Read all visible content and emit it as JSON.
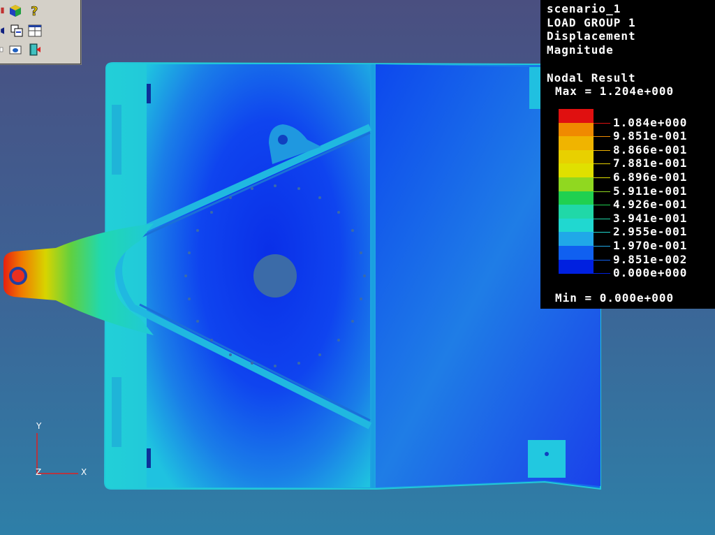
{
  "legend": {
    "lines": [
      "scenario_1",
      "LOAD GROUP 1",
      "Displacement",
      "Magnitude"
    ],
    "result_type": "Nodal Result",
    "max_label": "Max = 1.204e+000",
    "min_label": "Min = 0.000e+000",
    "bands": [
      {
        "color": "#e01010",
        "value": "1.084e+000"
      },
      {
        "color": "#f08a00",
        "value": "9.851e-001"
      },
      {
        "color": "#f0b400",
        "value": "8.866e-001"
      },
      {
        "color": "#e8d000",
        "value": "7.881e-001"
      },
      {
        "color": "#e0e000",
        "value": "6.896e-001"
      },
      {
        "color": "#90d820",
        "value": "5.911e-001"
      },
      {
        "color": "#20d050",
        "value": "4.926e-001"
      },
      {
        "color": "#20d8a8",
        "value": "3.941e-001"
      },
      {
        "color": "#20d8d0",
        "value": "2.955e-001"
      },
      {
        "color": "#20a8e8",
        "value": "1.970e-001"
      },
      {
        "color": "#1060f0",
        "value": "9.851e-002"
      },
      {
        "color": "#0020e0",
        "value": "0.000e+000"
      }
    ]
  },
  "axis": {
    "y": "Y",
    "z": "Z",
    "x": "X"
  },
  "toolbar": {
    "icons": [
      "color-cube-icon",
      "help-icon",
      "view-cube-icon",
      "copy-window-icon",
      "grid-layout-icon",
      "print-icon",
      "shaded-view-icon",
      "exit-icon"
    ]
  }
}
